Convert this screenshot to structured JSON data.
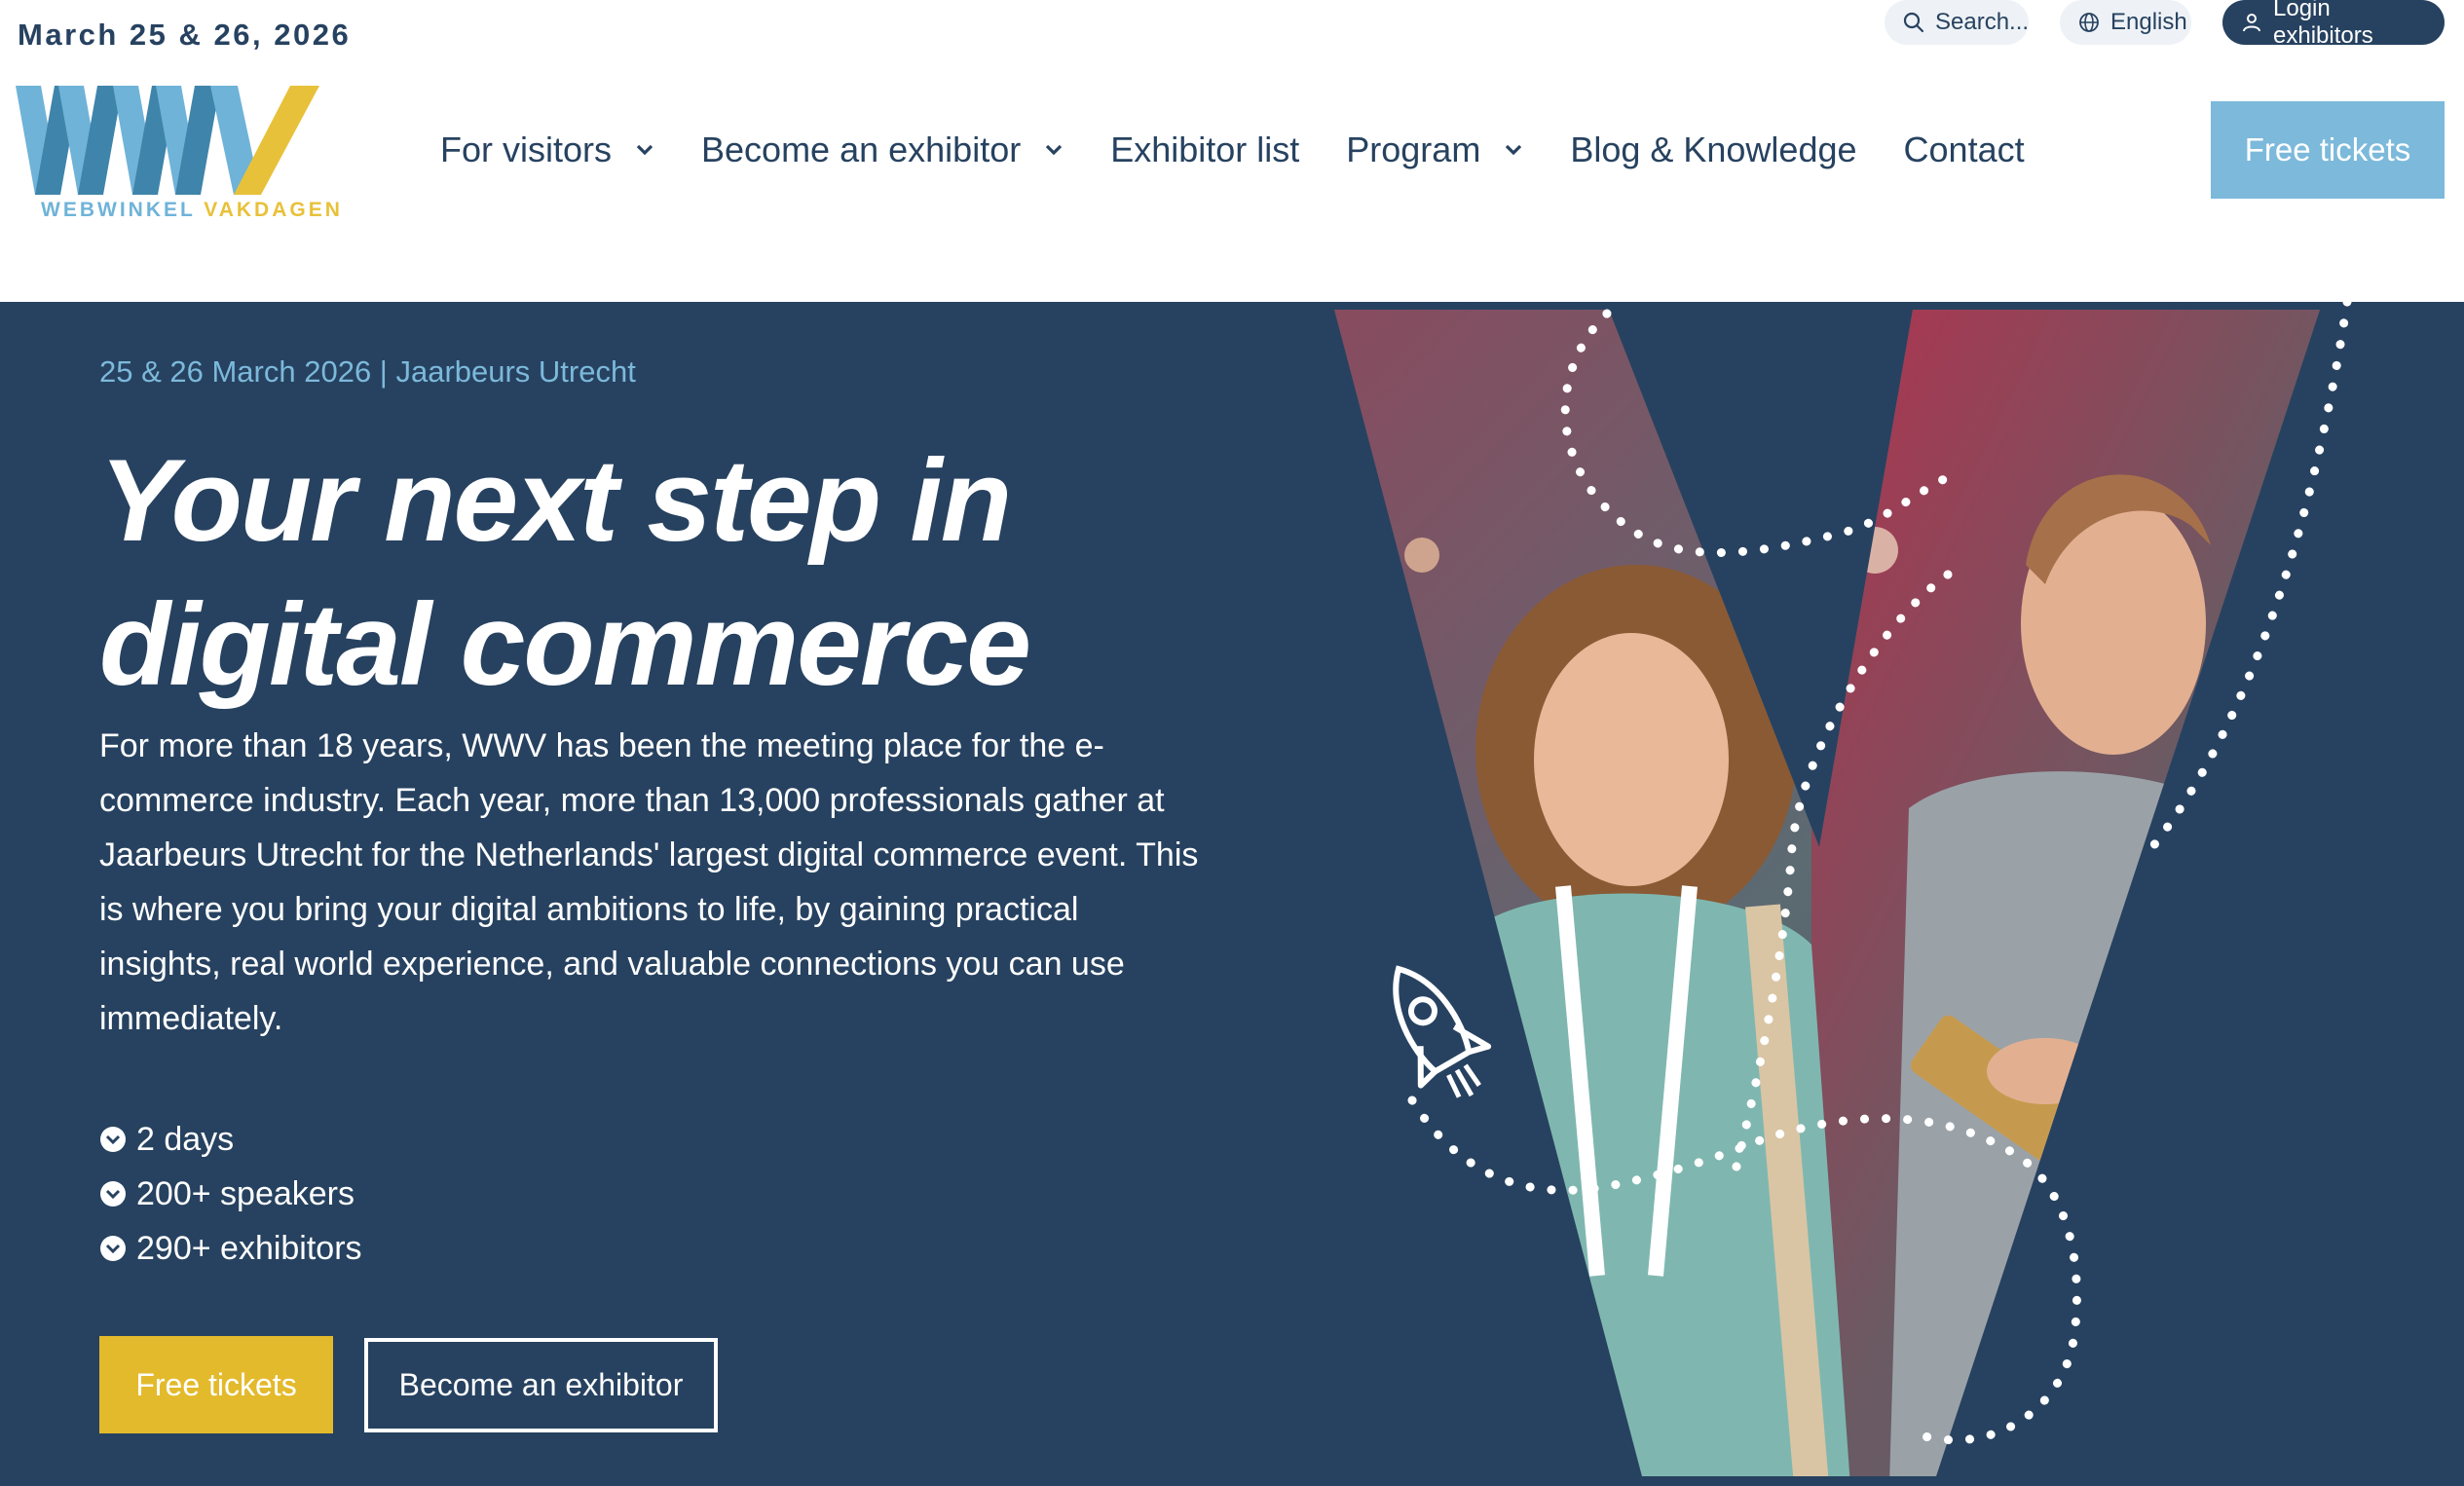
{
  "header": {
    "event_date": "March 25 & 26, 2026",
    "logo": {
      "mark": "WWV",
      "text_part1": "WEBWINKEL",
      "text_part2": "VAKDAGEN",
      "icon": "wwv-logo-icon"
    },
    "utility": {
      "search_label": "Search...",
      "language_label": "English",
      "login_label": "Login exhibitors"
    },
    "nav": [
      {
        "label": "For visitors",
        "has_dropdown": true
      },
      {
        "label": "Become an exhibitor",
        "has_dropdown": true
      },
      {
        "label": "Exhibitor list",
        "has_dropdown": false
      },
      {
        "label": "Program",
        "has_dropdown": true
      },
      {
        "label": "Blog & Knowledge",
        "has_dropdown": false
      },
      {
        "label": "Contact",
        "has_dropdown": false
      }
    ],
    "cta_label": "Free tickets"
  },
  "hero": {
    "subtitle": "25 & 26 March 2026 | Jaarbeurs Utrecht",
    "title": "Your next step in digital commerce",
    "description": "For more than 18 years, WWV has been the meeting place for the e-commerce industry. Each year, more than 13,000 professionals gather at Jaarbeurs Utrecht for the Netherlands' largest digital commerce event. This is where you bring your digital ambitions to life, by gaining practical insights, real world experience, and valuable connections you can use immediately.",
    "bullets": [
      "2 days",
      "200+ speakers",
      "290+ exhibitors"
    ],
    "primary_cta": "Free tickets",
    "secondary_cta": "Become an exhibitor",
    "visual": {
      "icons": [
        "rocket-icon",
        "dotted-path"
      ],
      "photo": "visitors-photo"
    }
  },
  "colors": {
    "navy": "#274260",
    "light_blue": "#7cb9db",
    "yellow": "#e3ba2c",
    "white": "#ffffff"
  }
}
